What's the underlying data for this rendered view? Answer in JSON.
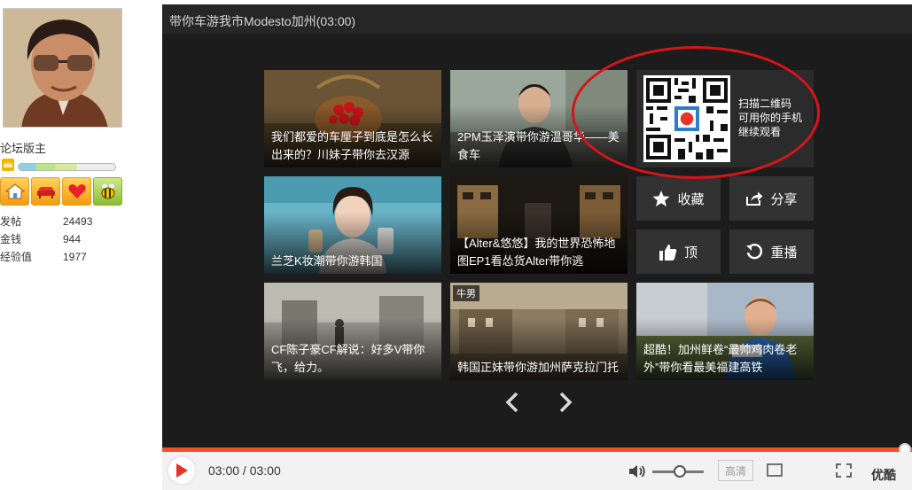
{
  "profile": {
    "role": "论坛版主",
    "stats": [
      {
        "label": "发帖",
        "value": "24493"
      },
      {
        "label": "金钱",
        "value": "944"
      },
      {
        "label": "经验值",
        "value": "1977"
      }
    ],
    "badge_icons": [
      "home-icon",
      "sofa-icon",
      "heart-icon",
      "bee-icon"
    ]
  },
  "player": {
    "title": "带你车游我市Modesto加州(03:00)",
    "qr_text": [
      "扫描二维码",
      "可用你的手机",
      "继续观看"
    ],
    "actions": {
      "favorite": "收藏",
      "share": "分享",
      "like": "顶",
      "replay": "重播"
    },
    "videos": [
      {
        "caption": "我们都爱的车厘子到底是怎么长出来的？川妹子带你去汉源"
      },
      {
        "caption": "2PM玉泽演带你游温哥华——美食车"
      },
      {
        "caption": "兰芝K妆潮带你游韩国"
      },
      {
        "caption": "【Alter&悠悠】我的世界恐怖地图EP1看怂货Alter带你逃"
      },
      {
        "caption": "CF陈子豪CF解说：好多V带你飞，给力。"
      },
      {
        "caption": "韩国正妹带你游加州萨克拉门托",
        "tag": "牛男"
      },
      {
        "caption": "超酷！加州鲜卷“最帅鸡肉卷老外”带你看最美福建高铁"
      }
    ],
    "controls": {
      "time": "03:00 / 03:00",
      "quality": "高清",
      "brand": "优酷",
      "progress": 1.0,
      "volume": 0.55
    },
    "colors": {
      "accent": "#f0502a",
      "highlight_ring": "#d8141a"
    }
  }
}
